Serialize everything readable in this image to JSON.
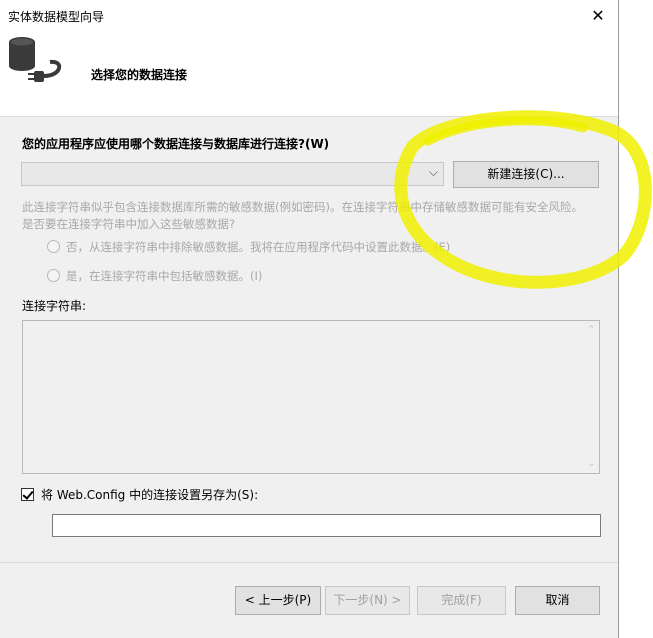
{
  "window": {
    "title": "实体数据模型向导",
    "close_glyph": "✕"
  },
  "header": {
    "title": "选择您的数据连接",
    "icon": "database-plug-icon"
  },
  "question": "您的应用程序应使用哪个数据连接与数据库进行连接?(W)",
  "connection_select": {
    "value": "",
    "chevron": "⌵"
  },
  "new_connection_button": "新建连接(C)...",
  "sensitive_text": "此连接字符串似乎包含连接数据库所需的敏感数据(例如密码)。在连接字符串中存储敏感数据可能有安全风险。是否要在连接字符串中加入这些敏感数据?",
  "radios": [
    {
      "label": "否，从连接字符串中排除敏感数据。我将在应用程序代码中设置此数据。(E)",
      "selected": false
    },
    {
      "label": "是，在连接字符串中包括敏感数据。(I)",
      "selected": false
    }
  ],
  "connection_string": {
    "label": "连接字符串:",
    "value": "",
    "scroll_up": "⌃",
    "scroll_down": "⌄"
  },
  "save_setting": {
    "label": "将 Web.Config 中的连接设置另存为(S):",
    "checked": true,
    "value": ""
  },
  "buttons": {
    "prev": "< 上一步(P)",
    "next": "下一步(N) >",
    "finish": "完成(F)",
    "cancel": "取消"
  },
  "colors": {
    "highlight": "#f0f000",
    "dialog_bg": "#f0f0f0",
    "disabled_text": "#a8a8a8"
  }
}
